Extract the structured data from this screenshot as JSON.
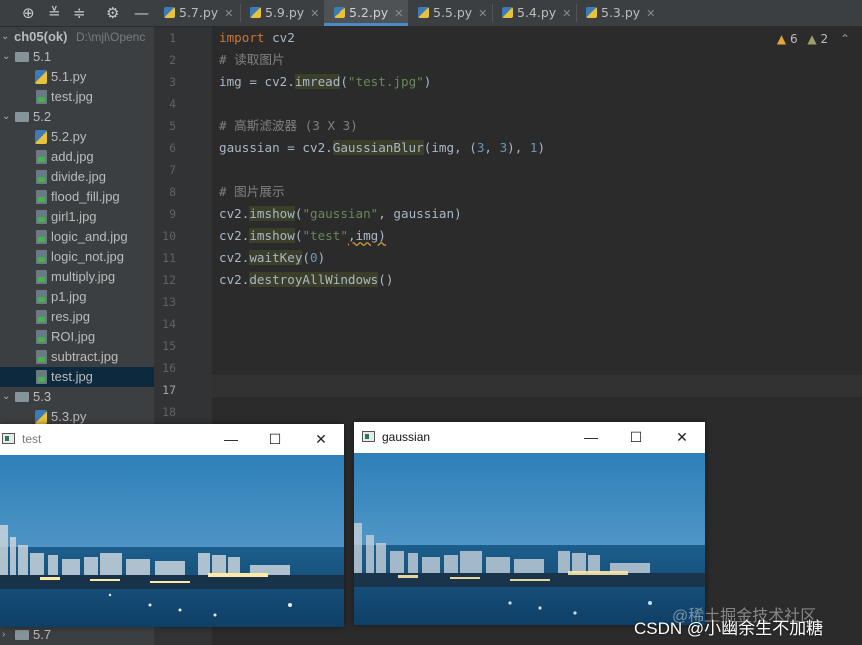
{
  "toolbar": {
    "icons": [
      "target-icon",
      "expand-all-icon",
      "collapse-all-icon",
      "gear-icon",
      "minimize-panel-icon"
    ]
  },
  "tabs": [
    {
      "label": "5.7.py",
      "active": false
    },
    {
      "label": "5.9.py",
      "active": false
    },
    {
      "label": "5.2.py",
      "active": true
    },
    {
      "label": "5.5.py",
      "active": false
    },
    {
      "label": "5.4.py",
      "active": false
    },
    {
      "label": "5.3.py",
      "active": false
    }
  ],
  "project": {
    "root_name": "ch05(ok)",
    "root_path": "D:\\mjl\\Openc",
    "items": [
      {
        "label": "5.1",
        "type": "folder"
      },
      {
        "label": "5.1.py",
        "type": "py"
      },
      {
        "label": "test.jpg",
        "type": "jpg"
      },
      {
        "label": "5.2",
        "type": "folder"
      },
      {
        "label": "5.2.py",
        "type": "py"
      },
      {
        "label": "add.jpg",
        "type": "jpg"
      },
      {
        "label": "divide.jpg",
        "type": "jpg"
      },
      {
        "label": "flood_fill.jpg",
        "type": "jpg"
      },
      {
        "label": "girl1.jpg",
        "type": "jpg"
      },
      {
        "label": "logic_and.jpg",
        "type": "jpg"
      },
      {
        "label": "logic_not.jpg",
        "type": "jpg"
      },
      {
        "label": "multiply.jpg",
        "type": "jpg"
      },
      {
        "label": "p1.jpg",
        "type": "jpg"
      },
      {
        "label": "res.jpg",
        "type": "jpg"
      },
      {
        "label": "ROI.jpg",
        "type": "jpg"
      },
      {
        "label": "subtract.jpg",
        "type": "jpg"
      },
      {
        "label": "test.jpg",
        "type": "jpg",
        "selected": true
      },
      {
        "label": "5.3",
        "type": "folder"
      },
      {
        "label": "5.3.py",
        "type": "py"
      }
    ],
    "bottom_folder": "5.7"
  },
  "editor": {
    "line_numbers": [
      "1",
      "2",
      "3",
      "4",
      "5",
      "6",
      "7",
      "8",
      "9",
      "10",
      "11",
      "12",
      "13",
      "14",
      "15",
      "16",
      "17",
      "18"
    ],
    "current_line": "17",
    "code": {
      "l1_kw": "import",
      "l1_rest": " cv2",
      "l2": "# 读取图片",
      "l3_a": "img = cv2.",
      "l3_fn": "imread",
      "l3_b": "(",
      "l3_str": "\"test.jpg\"",
      "l3_c": ")",
      "l5": "# 高斯滤波器 (3 X 3)",
      "l6_a": "gaussian = cv2.",
      "l6_fn": "GaussianBlur",
      "l6_b": "(img, (",
      "l6_n1": "3",
      "l6_c": ", ",
      "l6_n2": "3",
      "l6_d": "), ",
      "l6_n3": "1",
      "l6_e": ")",
      "l8": "# 图片展示",
      "l9_a": "cv2.",
      "l9_fn": "imshow",
      "l9_b": "(",
      "l9_str": "\"gaussian\"",
      "l9_c": ", gaussian)",
      "l10_a": "cv2.",
      "l10_fn": "imshow",
      "l10_b": "(",
      "l10_str": "\"test\"",
      "l10_c": ",img)",
      "l11_a": "cv2.",
      "l11_fn": "waitKey",
      "l11_b": "(",
      "l11_n": "0",
      "l11_c": ")",
      "l12_a": "cv2.",
      "l12_fn": "destroyAllWindows",
      "l12_b": "()"
    },
    "warnings_count": "6",
    "weak_warnings_count": "2"
  },
  "windows": {
    "test": {
      "title": "test"
    },
    "gaussian": {
      "title": "gaussian"
    },
    "minimize_glyph": "—",
    "maximize_glyph": "☐",
    "close_glyph": "✕"
  },
  "watermark": {
    "juejin": "@稀土掘金技术社区",
    "csdn": "CSDN @小幽余生不加糖"
  },
  "colors": {
    "keyword": "#cc7832",
    "string": "#6a8759",
    "number": "#6897bb",
    "comment": "#808080",
    "selection": "#0d293e",
    "tab_underline": "#4a88c7"
  }
}
